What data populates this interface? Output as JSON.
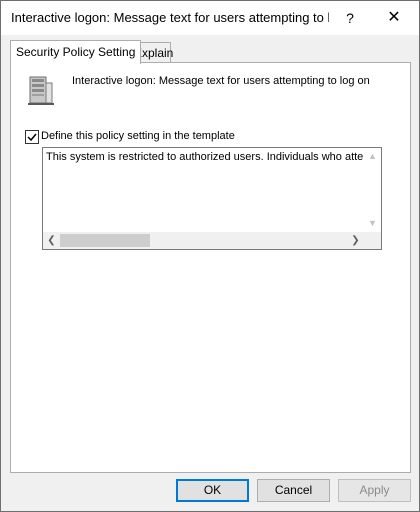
{
  "window": {
    "title": "Interactive logon: Message text for users attempting to lo...",
    "help_glyph": "?",
    "close_glyph": "✕"
  },
  "tabs": [
    {
      "label": "Security Policy Setting",
      "active": true
    },
    {
      "label": "Explain",
      "active": false
    }
  ],
  "policy": {
    "icon": "server-icon",
    "name": "Interactive logon: Message text for users attempting to log on"
  },
  "define_setting": {
    "label": "Define this policy setting in the template",
    "checked": true
  },
  "message_text": {
    "value": "This system is restricted to authorized users. Individuals who attemp"
  },
  "buttons": {
    "ok": "OK",
    "cancel": "Cancel",
    "apply": "Apply"
  },
  "colors": {
    "accent": "#0078d7",
    "panel": "#ffffff",
    "background": "#f0f0f0"
  }
}
